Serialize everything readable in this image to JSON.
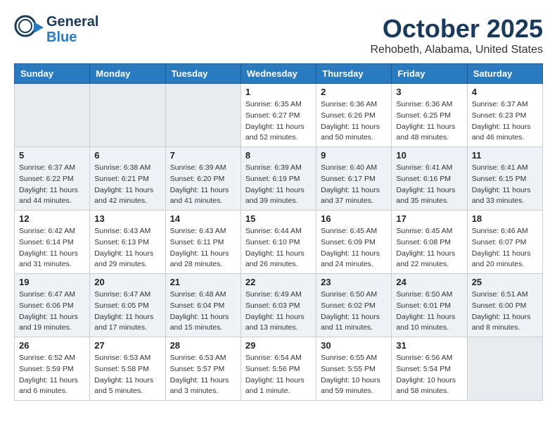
{
  "header": {
    "logo_line1": "General",
    "logo_line2": "Blue",
    "month": "October 2025",
    "location": "Rehobeth, Alabama, United States"
  },
  "weekdays": [
    "Sunday",
    "Monday",
    "Tuesday",
    "Wednesday",
    "Thursday",
    "Friday",
    "Saturday"
  ],
  "weeks": [
    [
      {
        "day": "",
        "info": ""
      },
      {
        "day": "",
        "info": ""
      },
      {
        "day": "",
        "info": ""
      },
      {
        "day": "1",
        "info": "Sunrise: 6:35 AM\nSunset: 6:27 PM\nDaylight: 11 hours\nand 52 minutes."
      },
      {
        "day": "2",
        "info": "Sunrise: 6:36 AM\nSunset: 6:26 PM\nDaylight: 11 hours\nand 50 minutes."
      },
      {
        "day": "3",
        "info": "Sunrise: 6:36 AM\nSunset: 6:25 PM\nDaylight: 11 hours\nand 48 minutes."
      },
      {
        "day": "4",
        "info": "Sunrise: 6:37 AM\nSunset: 6:23 PM\nDaylight: 11 hours\nand 46 minutes."
      }
    ],
    [
      {
        "day": "5",
        "info": "Sunrise: 6:37 AM\nSunset: 6:22 PM\nDaylight: 11 hours\nand 44 minutes."
      },
      {
        "day": "6",
        "info": "Sunrise: 6:38 AM\nSunset: 6:21 PM\nDaylight: 11 hours\nand 42 minutes."
      },
      {
        "day": "7",
        "info": "Sunrise: 6:39 AM\nSunset: 6:20 PM\nDaylight: 11 hours\nand 41 minutes."
      },
      {
        "day": "8",
        "info": "Sunrise: 6:39 AM\nSunset: 6:19 PM\nDaylight: 11 hours\nand 39 minutes."
      },
      {
        "day": "9",
        "info": "Sunrise: 6:40 AM\nSunset: 6:17 PM\nDaylight: 11 hours\nand 37 minutes."
      },
      {
        "day": "10",
        "info": "Sunrise: 6:41 AM\nSunset: 6:16 PM\nDaylight: 11 hours\nand 35 minutes."
      },
      {
        "day": "11",
        "info": "Sunrise: 6:41 AM\nSunset: 6:15 PM\nDaylight: 11 hours\nand 33 minutes."
      }
    ],
    [
      {
        "day": "12",
        "info": "Sunrise: 6:42 AM\nSunset: 6:14 PM\nDaylight: 11 hours\nand 31 minutes."
      },
      {
        "day": "13",
        "info": "Sunrise: 6:43 AM\nSunset: 6:13 PM\nDaylight: 11 hours\nand 29 minutes."
      },
      {
        "day": "14",
        "info": "Sunrise: 6:43 AM\nSunset: 6:11 PM\nDaylight: 11 hours\nand 28 minutes."
      },
      {
        "day": "15",
        "info": "Sunrise: 6:44 AM\nSunset: 6:10 PM\nDaylight: 11 hours\nand 26 minutes."
      },
      {
        "day": "16",
        "info": "Sunrise: 6:45 AM\nSunset: 6:09 PM\nDaylight: 11 hours\nand 24 minutes."
      },
      {
        "day": "17",
        "info": "Sunrise: 6:45 AM\nSunset: 6:08 PM\nDaylight: 11 hours\nand 22 minutes."
      },
      {
        "day": "18",
        "info": "Sunrise: 6:46 AM\nSunset: 6:07 PM\nDaylight: 11 hours\nand 20 minutes."
      }
    ],
    [
      {
        "day": "19",
        "info": "Sunrise: 6:47 AM\nSunset: 6:06 PM\nDaylight: 11 hours\nand 19 minutes."
      },
      {
        "day": "20",
        "info": "Sunrise: 6:47 AM\nSunset: 6:05 PM\nDaylight: 11 hours\nand 17 minutes."
      },
      {
        "day": "21",
        "info": "Sunrise: 6:48 AM\nSunset: 6:04 PM\nDaylight: 11 hours\nand 15 minutes."
      },
      {
        "day": "22",
        "info": "Sunrise: 6:49 AM\nSunset: 6:03 PM\nDaylight: 11 hours\nand 13 minutes."
      },
      {
        "day": "23",
        "info": "Sunrise: 6:50 AM\nSunset: 6:02 PM\nDaylight: 11 hours\nand 11 minutes."
      },
      {
        "day": "24",
        "info": "Sunrise: 6:50 AM\nSunset: 6:01 PM\nDaylight: 11 hours\nand 10 minutes."
      },
      {
        "day": "25",
        "info": "Sunrise: 6:51 AM\nSunset: 6:00 PM\nDaylight: 11 hours\nand 8 minutes."
      }
    ],
    [
      {
        "day": "26",
        "info": "Sunrise: 6:52 AM\nSunset: 5:59 PM\nDaylight: 11 hours\nand 6 minutes."
      },
      {
        "day": "27",
        "info": "Sunrise: 6:53 AM\nSunset: 5:58 PM\nDaylight: 11 hours\nand 5 minutes."
      },
      {
        "day": "28",
        "info": "Sunrise: 6:53 AM\nSunset: 5:57 PM\nDaylight: 11 hours\nand 3 minutes."
      },
      {
        "day": "29",
        "info": "Sunrise: 6:54 AM\nSunset: 5:56 PM\nDaylight: 11 hours\nand 1 minute."
      },
      {
        "day": "30",
        "info": "Sunrise: 6:55 AM\nSunset: 5:55 PM\nDaylight: 10 hours\nand 59 minutes."
      },
      {
        "day": "31",
        "info": "Sunrise: 6:56 AM\nSunset: 5:54 PM\nDaylight: 10 hours\nand 58 minutes."
      },
      {
        "day": "",
        "info": ""
      }
    ]
  ]
}
